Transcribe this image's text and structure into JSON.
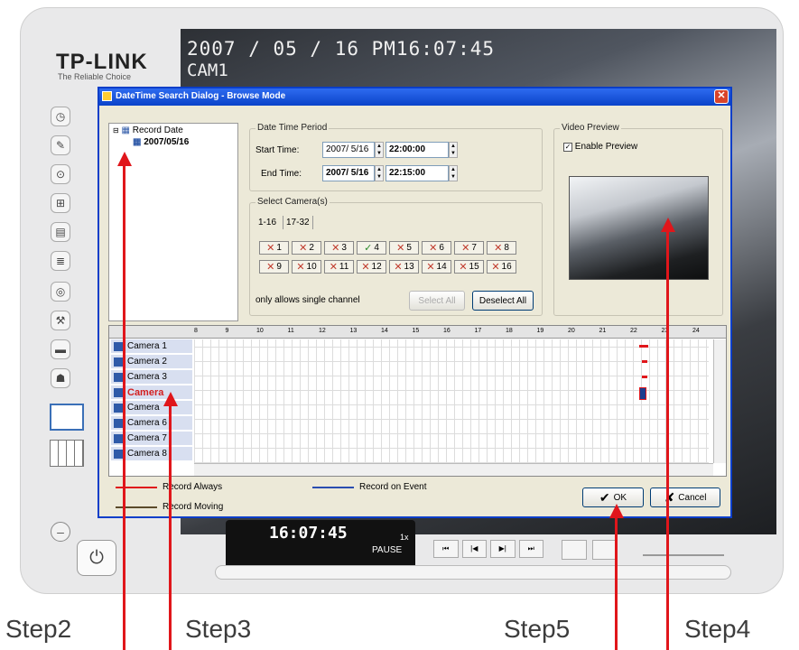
{
  "brand": {
    "logo": "TP-LINK",
    "tagline": "The Reliable Choice"
  },
  "video": {
    "timestamp": "2007 / 05 / 16   PM16:07:45",
    "camera": "CAM1"
  },
  "player": {
    "time": "16:07:45",
    "speed": "1x",
    "state": "PAUSE"
  },
  "dialog": {
    "title": "DateTime Search Dialog - Browse Mode",
    "tree": {
      "root": "Record Date",
      "child": "2007/05/16"
    },
    "period": {
      "label": "Date Time Period",
      "start_label": "Start Time:",
      "start_date": "2007/ 5/16",
      "start_time": "22:00:00",
      "end_label": "End Time:",
      "end_date": "2007/ 5/16",
      "end_time": "22:15:00"
    },
    "cameras": {
      "label": "Select Camera(s)",
      "tabs": [
        "1-16",
        "17-32"
      ],
      "row1": [
        "1",
        "2",
        "3",
        "4",
        "5",
        "6",
        "7",
        "8"
      ],
      "row2": [
        "9",
        "10",
        "11",
        "12",
        "13",
        "14",
        "15",
        "16"
      ],
      "checked": "4",
      "note": "only allows single channel",
      "select_all": "Select All",
      "deselect_all": "Deselect All"
    },
    "preview": {
      "label": "Video Preview",
      "enable": "Enable Preview"
    },
    "timeline": {
      "hours": [
        "8",
        "9",
        "10",
        "11",
        "12",
        "13",
        "14",
        "15",
        "16",
        "17",
        "18",
        "19",
        "20",
        "21",
        "22",
        "23",
        "24"
      ],
      "cameras": [
        "Camera 1",
        "Camera 2",
        "Camera 3",
        "Camera",
        "Camera",
        "Camera 6",
        "Camera 7",
        "Camera 8"
      ]
    },
    "legend": {
      "always": "Record Always",
      "moving": "Record Moving",
      "event": "Record on Event"
    },
    "ok": "OK",
    "cancel": "Cancel"
  },
  "steps": {
    "step2": "Step2",
    "step3": "Step3",
    "step5": "Step5",
    "step4": "Step4"
  },
  "colors": {
    "accent": "#e0161b",
    "titlebar": "#0a43c9",
    "dialog_bg": "#ece9d8"
  }
}
